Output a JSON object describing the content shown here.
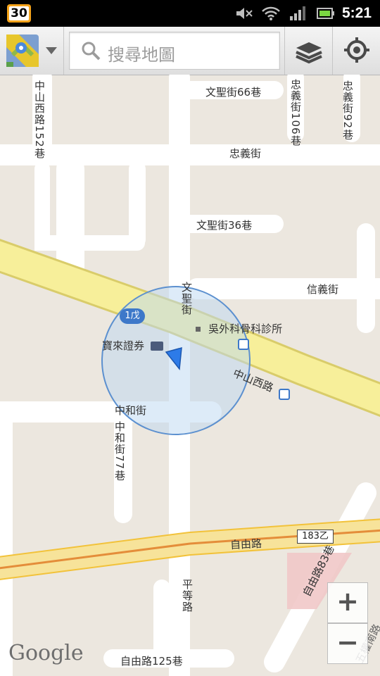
{
  "status_bar": {
    "badge": "30",
    "time": "5:21"
  },
  "action_bar": {
    "search_placeholder": "搜尋地圖"
  },
  "map": {
    "streets": {
      "zhongshan_w_152": "中山西路152巷",
      "wensheng_66": "文聖街66巷",
      "zhongyi_106": "忠義街106巷",
      "zhongyi_92": "忠義街92巷",
      "zhongyi": "忠義街",
      "wensheng_36": "文聖街36巷",
      "xinyi": "信義街",
      "wensheng": "文聖街",
      "zhongshan_w": "中山西路",
      "zhonghe": "中和街",
      "zhonghe_77": "中和街77巷",
      "ziyou": "自由路",
      "ziyou_83": "自由路83巷",
      "pingdeng": "平等路",
      "ziyou_125": "自由路125巷",
      "wuquan_s": "五權南路"
    },
    "shields": {
      "route_1": "1戊",
      "route_183": "183乙"
    },
    "pois": {
      "wu_clinic": "吳外科骨科診所",
      "baolai": "寶來證券"
    },
    "zoom_in": "+",
    "zoom_out": "−",
    "attribution": "Google"
  }
}
